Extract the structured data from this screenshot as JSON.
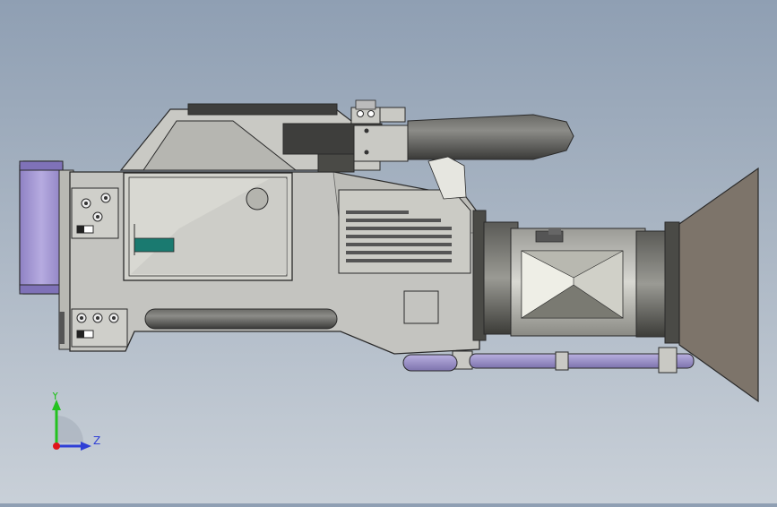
{
  "viewport": {
    "model": "camcorder-assembly",
    "view_orientation": "side"
  },
  "triad": {
    "y_label": "Y",
    "z_label": "Z",
    "y_color": "#23c21f",
    "z_color": "#2f3fd6",
    "x_color": "#e0141a"
  },
  "colors": {
    "body": "#c4c4c0",
    "body_dark": "#9a9a95",
    "panel": "#d2d2cc",
    "outline": "#2a2a2a",
    "battery": "#a79bd6",
    "rod": "#9b92c9",
    "hood": "#7d746a",
    "lens_dark": "#4a4a46",
    "tube": "#4f4f4c",
    "teal": "#1a7a70"
  }
}
